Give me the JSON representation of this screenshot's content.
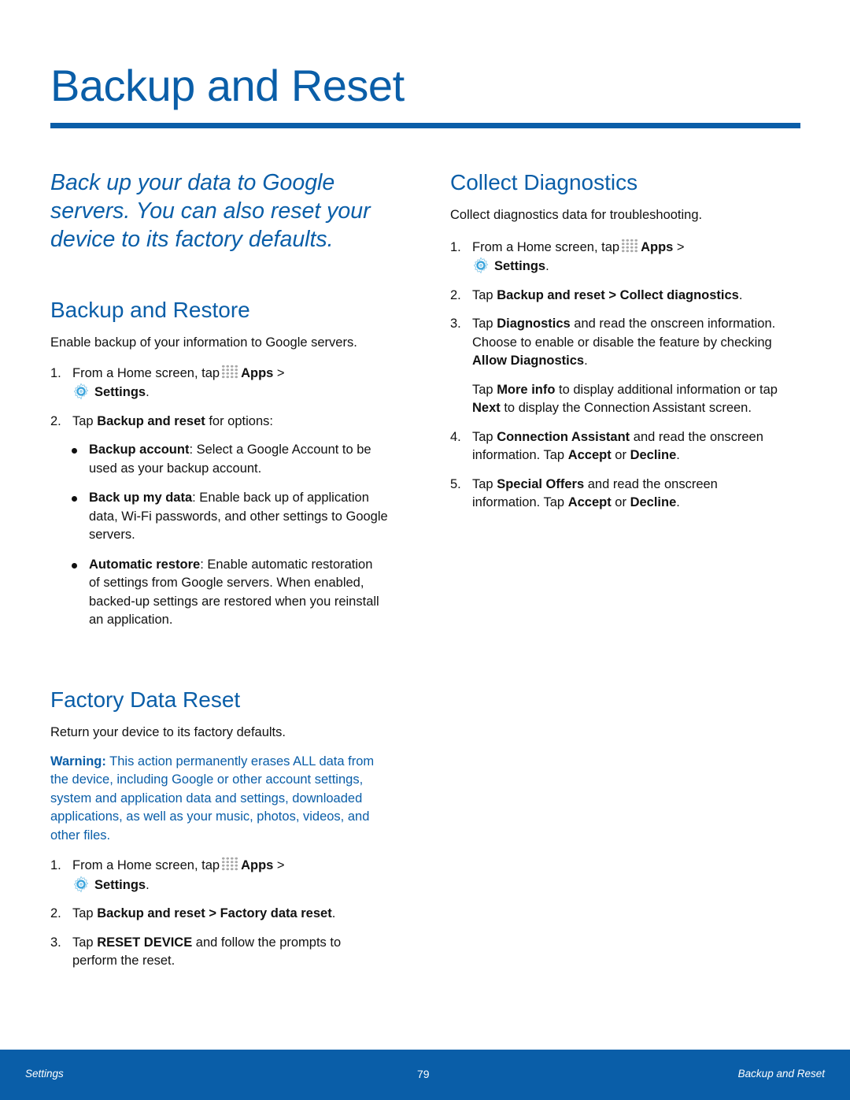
{
  "page": {
    "title": "Backup and Reset",
    "intro": "Back up your data to Google servers. You can also reset your device to its factory defaults."
  },
  "icons": {
    "apps": "apps-grid-icon",
    "settings": "settings-gear-icon"
  },
  "colors": {
    "accent": "#0a5ea8",
    "text": "#111111",
    "footer_text": "#ffffff"
  },
  "backup_restore": {
    "heading": "Backup and Restore",
    "description": "Enable backup of your information to Google servers.",
    "step1": {
      "num": "1.",
      "pre": "From a Home screen, tap",
      "apps": "Apps",
      "sep": " >",
      "settings": "Settings",
      "end": "."
    },
    "step2": {
      "num": "2.",
      "pre": "Tap ",
      "bold": "Backup and reset",
      "post": " for options:"
    },
    "bullets": [
      {
        "term": "Backup account",
        "text": ": Select a Google Account to be used as your backup account."
      },
      {
        "term": "Back up my data",
        "text": ": Enable back up of application data, Wi-Fi passwords, and other settings to Google servers."
      },
      {
        "term": "Automatic restore",
        "text": ": Enable automatic restoration of settings from Google servers. When enabled, backed-up settings are restored when you reinstall an application."
      }
    ]
  },
  "factory_reset": {
    "heading": "Factory Data Reset",
    "description": "Return your device to its factory defaults.",
    "warning_label": "Warning:",
    "warning_text": " This action permanently erases ALL data from the device, including Google or other account settings, system and application data and settings, downloaded applications, as well as your music, photos, videos, and other files.",
    "step1": {
      "num": "1.",
      "pre": "From a Home screen, tap",
      "apps": "Apps",
      "sep": " >",
      "settings": "Settings",
      "end": "."
    },
    "step2": {
      "num": "2.",
      "pre": "Tap ",
      "bold1": "Backup and reset",
      "sep": " > ",
      "bold2": "Factory data reset",
      "end": "."
    },
    "step3": {
      "num": "3.",
      "pre": "Tap ",
      "bold": "RESET DEVICE",
      "post": " and follow the prompts to perform the reset."
    }
  },
  "collect_diagnostics": {
    "heading": "Collect Diagnostics",
    "description": "Collect diagnostics data for troubleshooting.",
    "step1": {
      "num": "1.",
      "pre": "From a Home screen, tap",
      "apps": "Apps",
      "sep": " >",
      "settings": "Settings",
      "end": "."
    },
    "step2": {
      "num": "2.",
      "pre": "Tap ",
      "bold1": "Backup and reset",
      "sep": " > ",
      "bold2": "Collect diagnostics",
      "end": "."
    },
    "step3": {
      "num": "3.",
      "pre": "Tap ",
      "bold1": "Diagnostics",
      "mid": " and read the onscreen information. Choose to enable or disable the feature by checking ",
      "bold2": "Allow Diagnostics",
      "end": "."
    },
    "step3_note": {
      "pre": "Tap ",
      "bold1": "More info",
      "mid": " to display additional information or tap ",
      "bold2": "Next",
      "post": " to display the Connection Assistant screen."
    },
    "step4": {
      "num": "4.",
      "pre": "Tap ",
      "bold1": "Connection Assistant",
      "mid": " and read the onscreen information. Tap ",
      "bold2": "Accept",
      "or": " or ",
      "bold3": "Decline",
      "end": "."
    },
    "step5": {
      "num": "5.",
      "pre": "Tap ",
      "bold1": "Special Offers",
      "mid": " and read the onscreen information. Tap ",
      "bold2": "Accept",
      "or": " or ",
      "bold3": "Decline",
      "end": "."
    }
  },
  "footer": {
    "left": "Settings",
    "page_number": "79",
    "right": "Backup and Reset"
  }
}
